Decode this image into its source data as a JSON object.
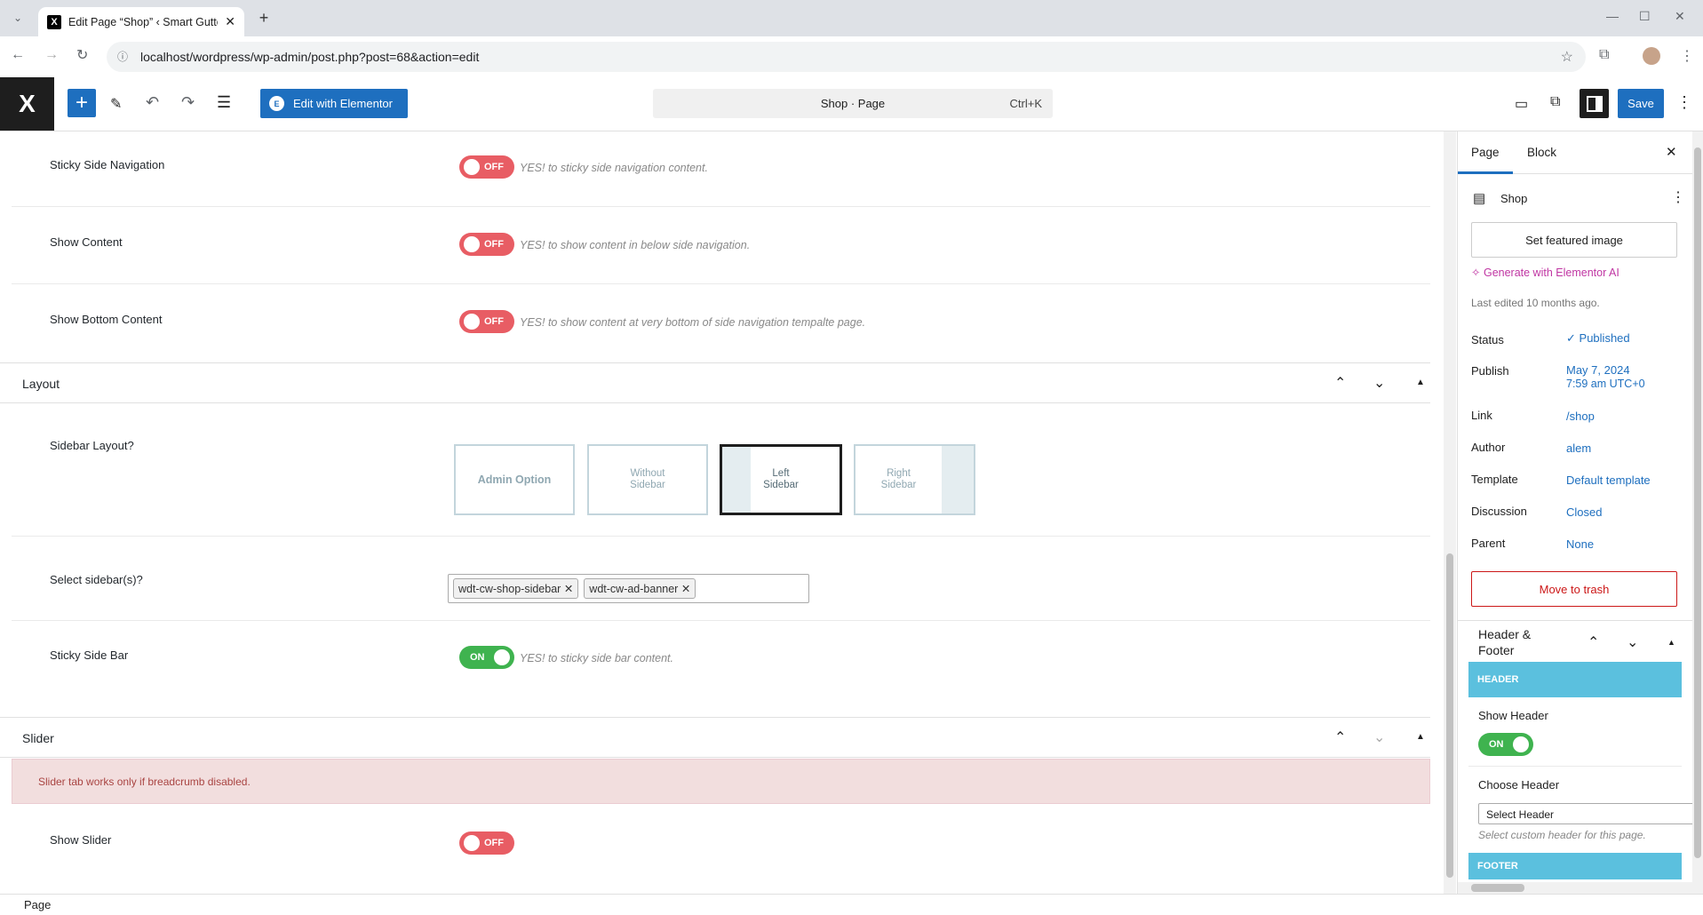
{
  "browser": {
    "tab_title": "Edit Page “Shop” ‹ Smart Gutter",
    "url": "localhost/wordpress/wp-admin/post.php?post=68&action=edit"
  },
  "topbar": {
    "edit_elementor": "Edit with Elementor",
    "command": "Shop · Page",
    "shortcut": "Ctrl+K",
    "save": "Save"
  },
  "nav": {
    "sticky_nav": {
      "label": "Sticky Side Navigation",
      "state": "OFF",
      "hint": "YES! to sticky side navigation content."
    },
    "show_content": {
      "label": "Show Content",
      "state": "OFF",
      "hint": "YES! to show content in below side navigation."
    },
    "bottom_content": {
      "label": "Show Bottom Content",
      "state": "OFF",
      "hint": "YES! to show content at very bottom of side navigation tempalte page."
    }
  },
  "layout": {
    "title": "Layout",
    "sidebar_layout_label": "Sidebar Layout?",
    "options": [
      "Admin Option",
      "Without Sidebar",
      "Left Sidebar",
      "Right Sidebar"
    ],
    "selected": "Left Sidebar",
    "select_sidebars_label": "Select sidebar(s)?",
    "sidebars": [
      "wdt-cw-shop-sidebar",
      "wdt-cw-ad-banner"
    ],
    "sticky_bar": {
      "label": "Sticky Side Bar",
      "state": "ON",
      "hint": "YES! to sticky side bar content."
    }
  },
  "slider": {
    "title": "Slider",
    "notice": "Slider tab works only if breadcrumb disabled.",
    "show_slider": {
      "label": "Show Slider",
      "state": "OFF"
    }
  },
  "sidebar": {
    "tab_page": "Page",
    "tab_block": "Block",
    "doc_title": "Shop",
    "featured": "Set featured image",
    "ai": "Generate with Elementor AI",
    "last_edited": "Last edited 10 months ago.",
    "status_l": "Status",
    "status_v": "Published",
    "publish_l": "Publish",
    "publish_v1": "May 7, 2024",
    "publish_v2": "7:59 am UTC+0",
    "link_l": "Link",
    "link_v": "/shop",
    "author_l": "Author",
    "author_v": "alem",
    "template_l": "Template",
    "template_v": "Default template",
    "discussion_l": "Discussion",
    "discussion_v": "Closed",
    "parent_l": "Parent",
    "parent_v": "None",
    "trash": "Move to trash",
    "hf_title1": "Header &",
    "hf_title2": "Footer",
    "header_band": "HEADER",
    "show_header": "Show Header",
    "show_header_state": "ON",
    "choose_header": "Choose Header",
    "select_header": "Select Header",
    "header_hint": "Select custom header for this page.",
    "footer_band": "FOOTER"
  },
  "statusbar": "Page",
  "colors": {
    "accent": "#1e6fbf",
    "off": "#e85d64",
    "on": "#3fb34f",
    "ai": "#c036a3",
    "trash": "#cc1818"
  }
}
